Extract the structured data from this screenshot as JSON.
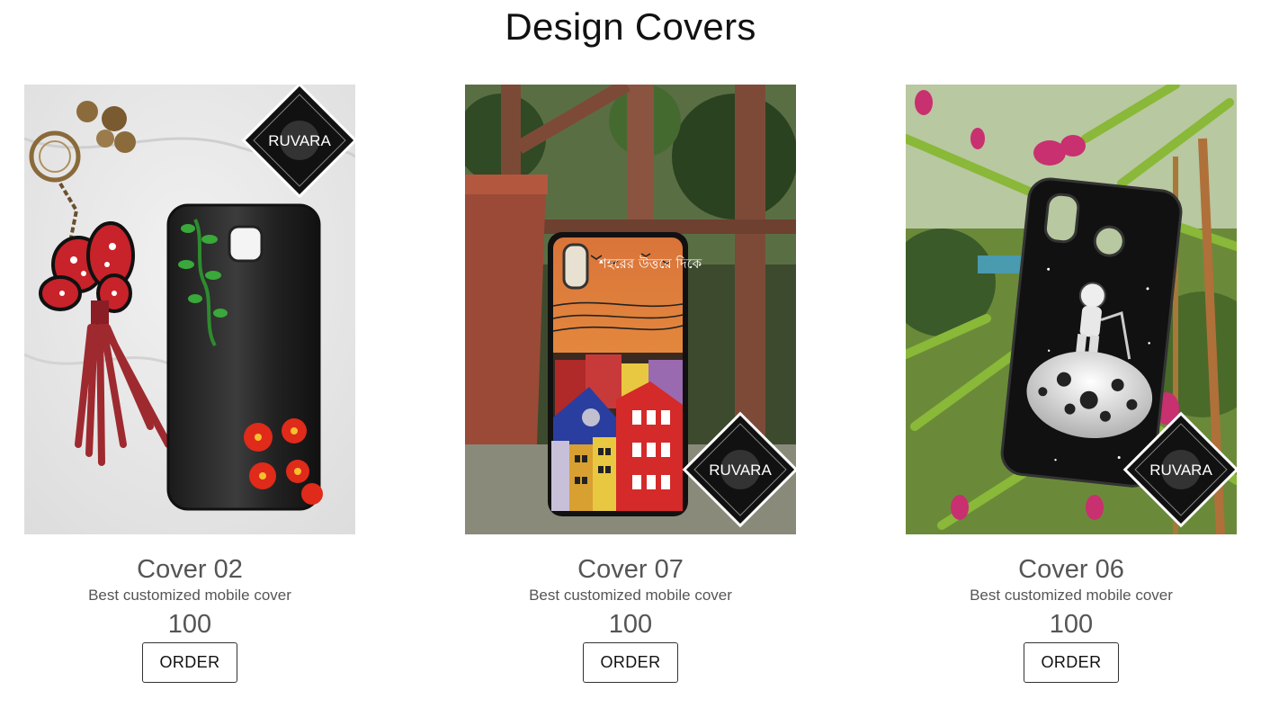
{
  "page": {
    "title": "Design Covers"
  },
  "brand": {
    "logo_text": "RUVARA"
  },
  "products": [
    {
      "title": "Cover 02",
      "description": "Best customized mobile cover",
      "price": "100",
      "button_label": "ORDER",
      "photo_alt": "Black phone cover with green vine and red flowers"
    },
    {
      "title": "Cover 07",
      "description": "Best customized mobile cover",
      "price": "100",
      "button_label": "ORDER",
      "photo_alt": "Orange phone cover with painted city buildings",
      "cover_lettering": "শহরের উত্তরে দিকে"
    },
    {
      "title": "Cover 06",
      "description": "Best customized mobile cover",
      "price": "100",
      "button_label": "ORDER",
      "photo_alt": "Black phone cover with astronaut on the moon"
    }
  ],
  "colors": {
    "text_muted": "#555555",
    "title": "#111111",
    "button_border": "#333333"
  }
}
